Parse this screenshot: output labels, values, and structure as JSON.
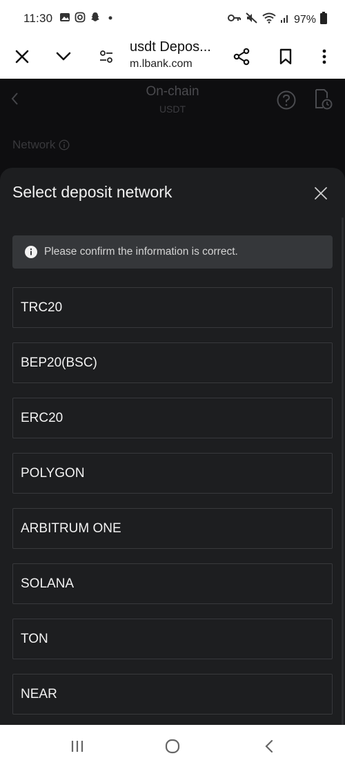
{
  "status_bar": {
    "time": "11:30",
    "battery": "97%",
    "left_icons": [
      "image-icon",
      "instagram-icon",
      "snapchat-icon",
      "dot-icon"
    ],
    "right_icons": [
      "key-icon",
      "mute-icon",
      "wifi-icon",
      "signal-icon",
      "battery-icon"
    ]
  },
  "browser": {
    "page_title": "usdt Depos...",
    "host": "m.lbank.com"
  },
  "app_header": {
    "title": "On-chain",
    "subtitle": "USDT",
    "network_label": "Network"
  },
  "sheet": {
    "title": "Select deposit network",
    "notice": "Please confirm the information is correct.",
    "networks": [
      "TRC20",
      "BEP20(BSC)",
      "ERC20",
      "POLYGON",
      "ARBITRUM ONE",
      "SOLANA",
      "TON",
      "NEAR"
    ]
  },
  "colors": {
    "sheet_bg": "#1d1e20",
    "page_bg": "#0e0e10",
    "item_border": "#38393c",
    "notice_bg": "#35373a"
  }
}
